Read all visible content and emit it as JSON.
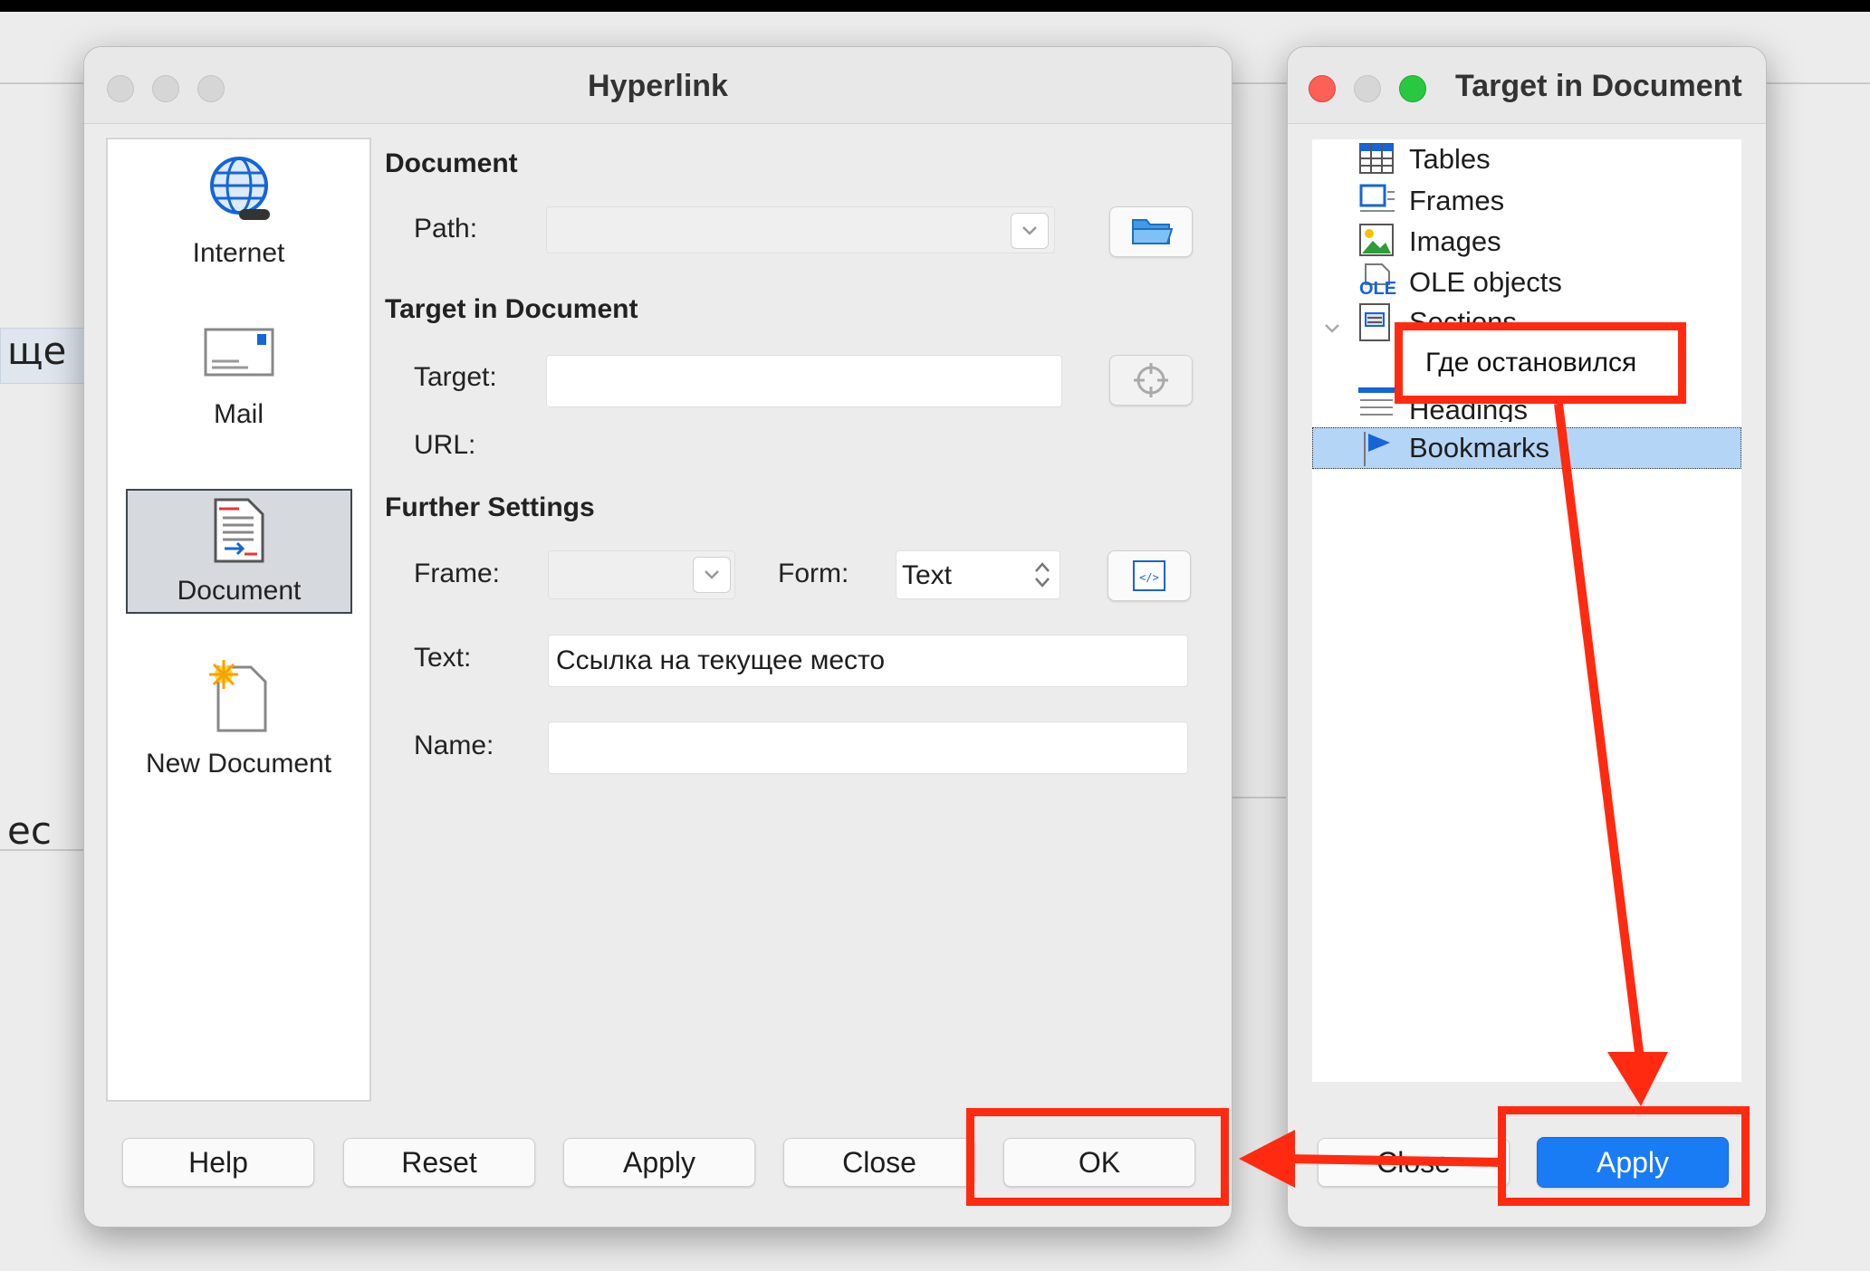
{
  "background_doc": {
    "text_fragment_1": "ще",
    "text_fragment_2": "ес"
  },
  "hyperlink_dialog": {
    "title": "Hyperlink",
    "categories": [
      {
        "label": "Internet",
        "icon": "globe-icon"
      },
      {
        "label": "Mail",
        "icon": "envelope-icon"
      },
      {
        "label": "Document",
        "icon": "document-icon",
        "selected": true
      },
      {
        "label": "New Document",
        "icon": "new-document-icon"
      }
    ],
    "section_document": "Document",
    "path_label": "Path:",
    "path_value": "",
    "section_target": "Target in Document",
    "target_label": "Target:",
    "target_value": "",
    "url_label": "URL:",
    "section_further": "Further Settings",
    "frame_label": "Frame:",
    "frame_value": "",
    "form_label": "Form:",
    "form_value": "Text",
    "text_label": "Text:",
    "text_value": "Ссылка на текущее место",
    "name_label": "Name:",
    "name_value": "",
    "buttons": {
      "help": "Help",
      "reset": "Reset",
      "apply": "Apply",
      "close": "Close",
      "ok": "OK"
    }
  },
  "target_window": {
    "title": "Target in Document",
    "tree": [
      {
        "label": "Tables",
        "icon": "table-icon"
      },
      {
        "label": "Frames",
        "icon": "frame-icon"
      },
      {
        "label": "Images",
        "icon": "image-icon"
      },
      {
        "label": "OLE objects",
        "icon": "ole-icon"
      },
      {
        "label": "Sections",
        "icon": "section-icon",
        "expanded": true
      },
      {
        "label": "Где остановился",
        "child_of": "Sections"
      },
      {
        "label": "Headings",
        "icon": "headings-icon"
      },
      {
        "label": "Bookmarks",
        "icon": "bookmark-flag-icon",
        "selected": true
      }
    ],
    "ole_icon_text": "OLE",
    "buttons": {
      "close": "Close",
      "apply": "Apply"
    }
  },
  "colors": {
    "annotation_red": "#ff2a10",
    "apply_blue": "#1a7cf5",
    "selection_blue": "#b5d5f7"
  }
}
